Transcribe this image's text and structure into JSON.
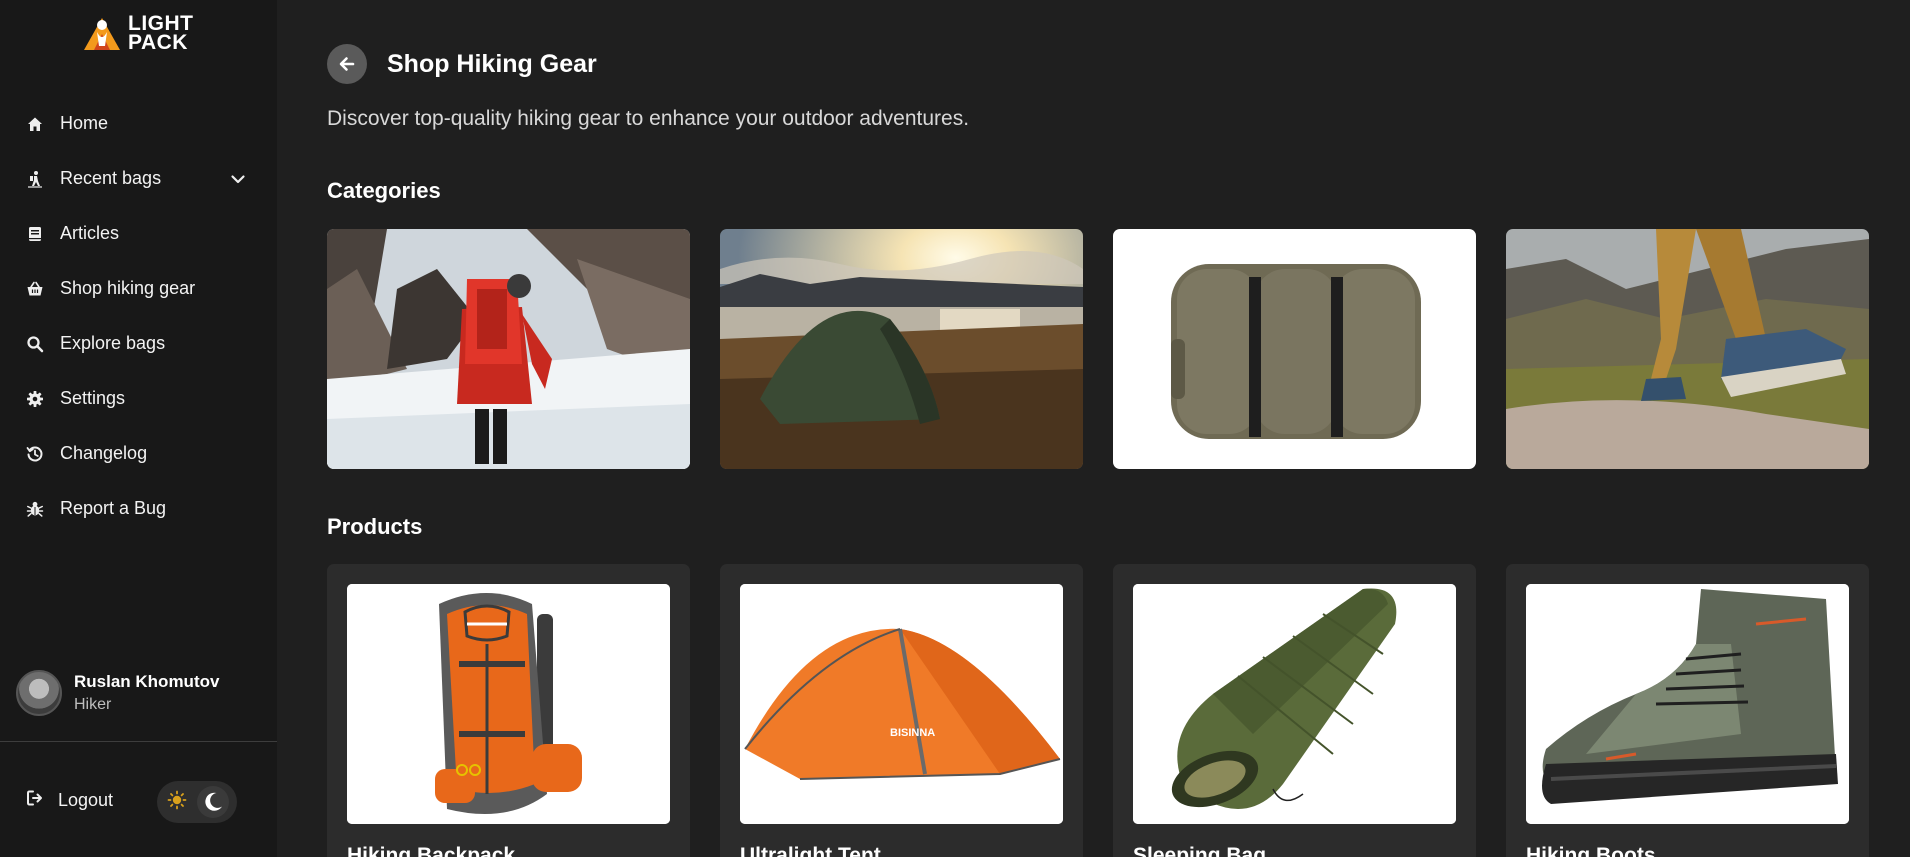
{
  "brand": {
    "line1": "LIGHT",
    "line2": "PACK",
    "accent": "#f39a1c"
  },
  "nav": {
    "items": [
      {
        "label": "Home",
        "icon": "home-icon"
      },
      {
        "label": "Recent bags",
        "icon": "hiker-icon",
        "has_chevron": true
      },
      {
        "label": "Articles",
        "icon": "book-icon"
      },
      {
        "label": "Shop hiking gear",
        "icon": "basket-icon"
      },
      {
        "label": "Explore bags",
        "icon": "search-icon"
      },
      {
        "label": "Settings",
        "icon": "gear-icon"
      },
      {
        "label": "Changelog",
        "icon": "history-icon"
      },
      {
        "label": "Report a Bug",
        "icon": "bug-icon"
      }
    ]
  },
  "user": {
    "name": "Ruslan Khomutov",
    "role": "Hiker"
  },
  "footer": {
    "logout_label": "Logout",
    "theme": "dark"
  },
  "page": {
    "title": "Shop Hiking Gear",
    "subtitle": "Discover top-quality hiking gear to enhance your outdoor adventures.",
    "categories_heading": "Categories",
    "products_heading": "Products"
  },
  "categories": [
    {
      "image": "hiker-in-snow-mountains"
    },
    {
      "image": "tent-at-sunset-lake"
    },
    {
      "image": "rolled-sleeping-bag"
    },
    {
      "image": "hiking-boots-on-rock"
    }
  ],
  "products": [
    {
      "name": "Hiking Backpack",
      "image": "orange-backpack"
    },
    {
      "name": "Ultralight Tent",
      "image": "orange-tent"
    },
    {
      "name": "Sleeping Bag",
      "image": "green-sleeping-bag"
    },
    {
      "name": "Hiking Boots",
      "image": "green-hiking-boot"
    }
  ]
}
